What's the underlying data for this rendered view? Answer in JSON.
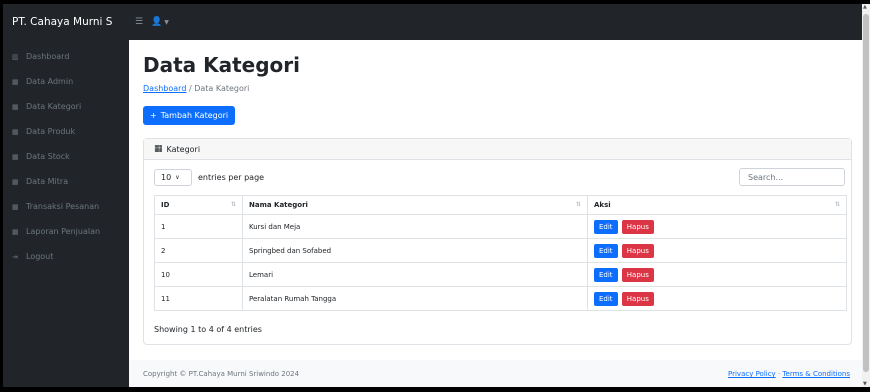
{
  "navbar": {
    "brand": "PT. Cahaya Murni S",
    "toggle_icon": "hamburger-icon",
    "user_icon": "user-icon"
  },
  "sidebar": {
    "items": [
      {
        "label": "Dashboard",
        "icon": "dashboard-icon"
      },
      {
        "label": "Data Admin",
        "icon": "table-icon"
      },
      {
        "label": "Data Kategori",
        "icon": "table-icon"
      },
      {
        "label": "Data Produk",
        "icon": "table-icon"
      },
      {
        "label": "Data Stock",
        "icon": "table-icon"
      },
      {
        "label": "Data Mitra",
        "icon": "table-icon"
      },
      {
        "label": "Transaksi Pesanan",
        "icon": "table-icon"
      },
      {
        "label": "Laporan Penjualan",
        "icon": "table-icon"
      },
      {
        "label": "Logout",
        "icon": "logout-icon"
      }
    ]
  },
  "page": {
    "title": "Data Kategori",
    "breadcrumb_link": "Dashboard",
    "breadcrumb_sep": "/",
    "breadcrumb_current": "Data Kategori",
    "add_button": "Tambah Kategori"
  },
  "card": {
    "header": "Kategori",
    "length_value": "10",
    "length_label": "entries per page",
    "search_placeholder": "Search...",
    "columns": [
      "ID",
      "Nama Kategori",
      "Aksi"
    ],
    "rows": [
      {
        "id": "1",
        "name": "Kursi dan Meja"
      },
      {
        "id": "2",
        "name": "Springbed dan Sofabed"
      },
      {
        "id": "10",
        "name": "Lemari"
      },
      {
        "id": "11",
        "name": "Peralatan Rumah Tangga"
      }
    ],
    "edit_label": "Edit",
    "delete_label": "Hapus",
    "info": "Showing 1 to 4 of 4 entries"
  },
  "footer": {
    "copyright": "Copyright © PT.Cahaya Murni Sriwindo 2024",
    "privacy": "Privacy Policy",
    "sep": "·",
    "terms": "Terms & Conditions"
  },
  "colors": {
    "primary": "#0d6efd",
    "danger": "#dc3545",
    "sidebar_bg": "#212529"
  }
}
